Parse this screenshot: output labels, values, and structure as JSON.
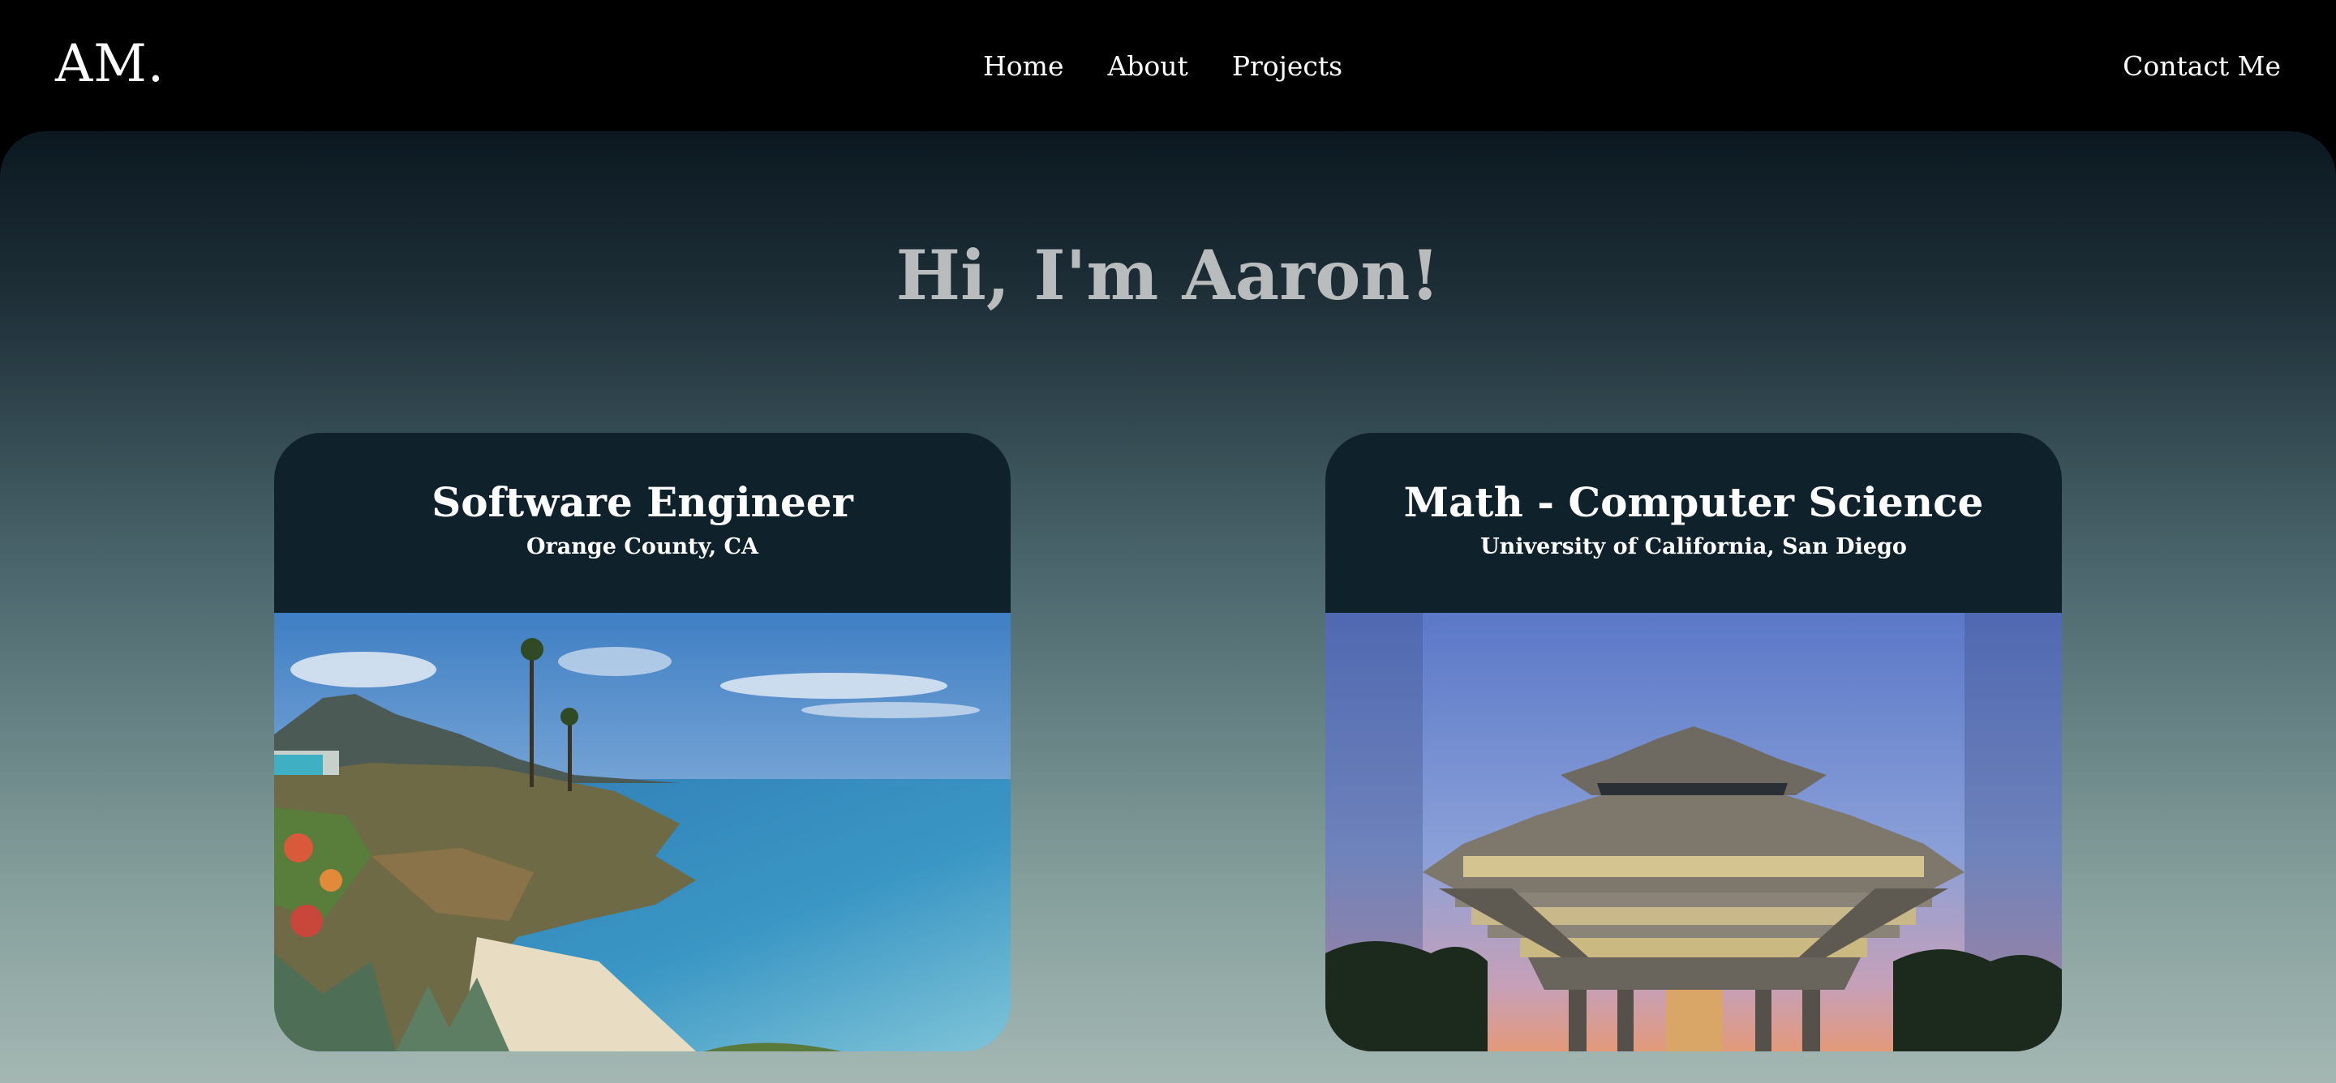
{
  "header": {
    "logo": "AM.",
    "nav": [
      "Home",
      "About",
      "Projects"
    ],
    "contact": "Contact Me"
  },
  "hero": {
    "greeting": "Hi, I'm Aaron!"
  },
  "cards": [
    {
      "title": "Software Engineer",
      "subtitle": "Orange County, CA"
    },
    {
      "title": "Math - Computer Science",
      "subtitle": "University of California, San Diego"
    }
  ]
}
